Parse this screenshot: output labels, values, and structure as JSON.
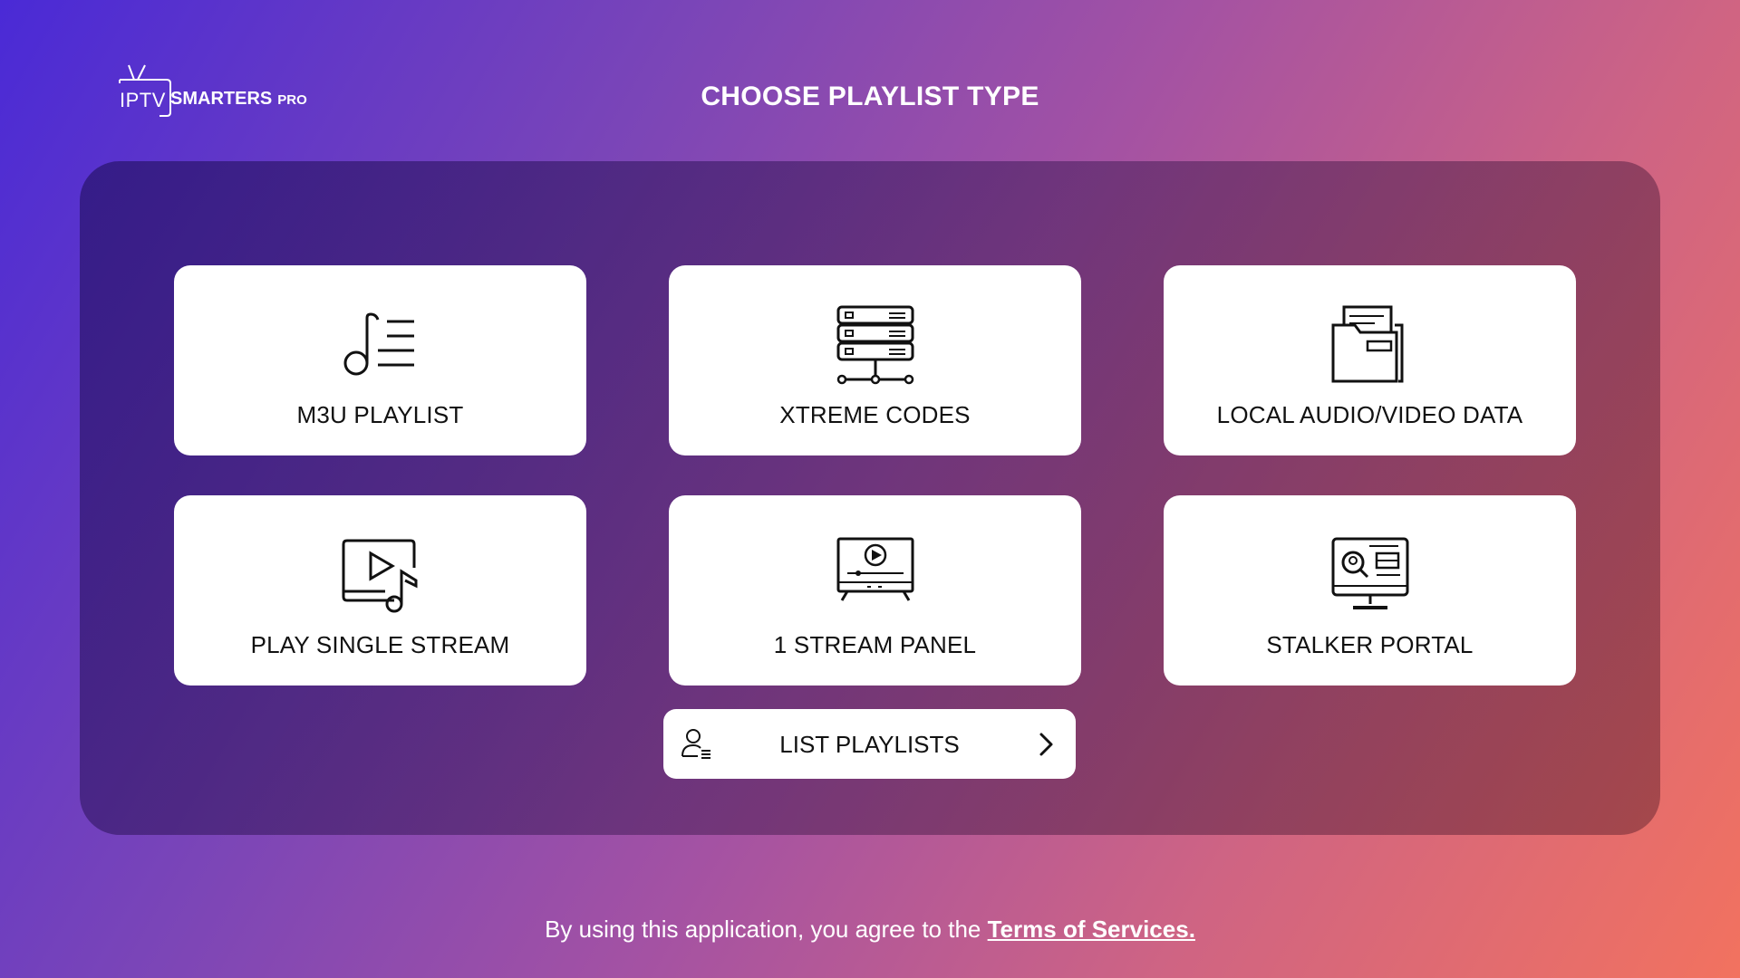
{
  "app": {
    "logo_iptv": "IPTV",
    "logo_brand": "SMARTERS",
    "logo_pro": "PRO"
  },
  "page_title": "CHOOSE PLAYLIST TYPE",
  "cards": [
    {
      "label": "M3U PLAYLIST",
      "icon": "music-list-icon"
    },
    {
      "label": "XTREME CODES",
      "icon": "server-icon"
    },
    {
      "label": "LOCAL AUDIO/VIDEO DATA",
      "icon": "folder-files-icon"
    },
    {
      "label": "PLAY SINGLE STREAM",
      "icon": "video-music-icon"
    },
    {
      "label": "1 STREAM PANEL",
      "icon": "tv-play-icon"
    },
    {
      "label": "STALKER PORTAL",
      "icon": "monitor-search-icon"
    }
  ],
  "list_playlists": {
    "label": "LIST PLAYLISTS",
    "icon": "user-list-icon",
    "chevron": "chevron-right-icon"
  },
  "footer": {
    "text": "By using this application, you agree to the",
    "link": "Terms of Services."
  },
  "colors": {
    "gradient_start": "#4a2ad6",
    "gradient_end": "#f2725f",
    "card_bg": "#ffffff",
    "text_dark": "#111111"
  }
}
